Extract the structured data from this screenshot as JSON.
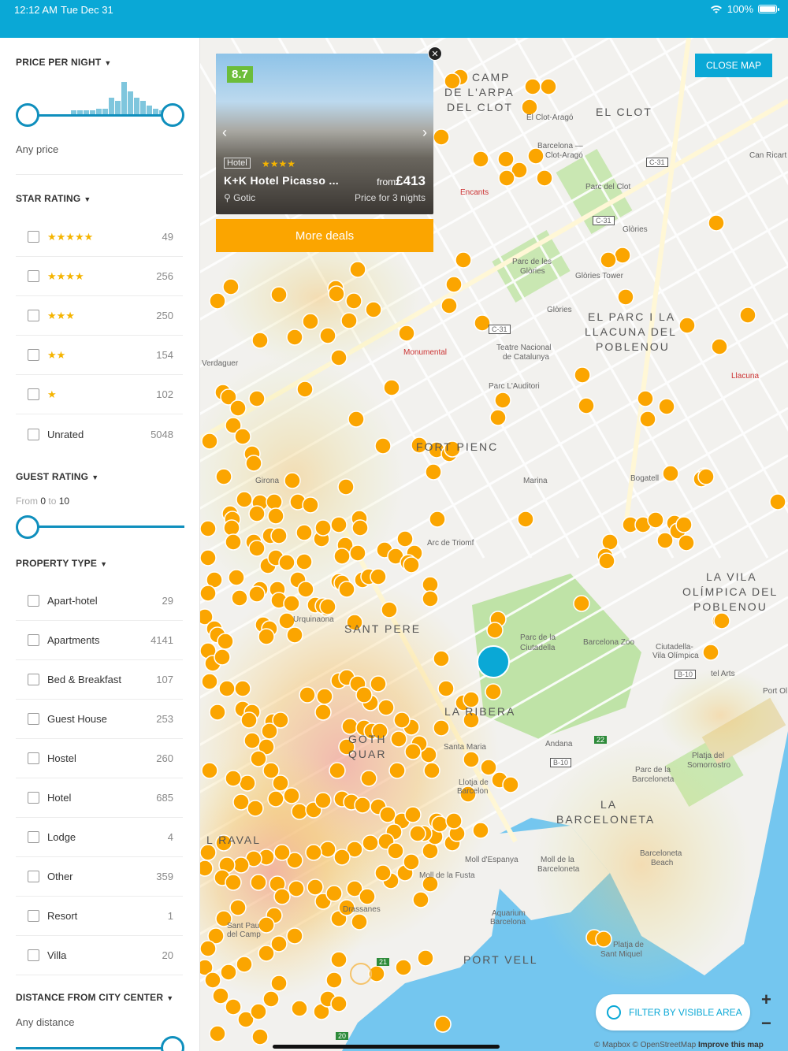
{
  "status": {
    "time": "12:12 AM",
    "date": "Tue Dec 31",
    "battery": "100%"
  },
  "sidebar": {
    "price": {
      "title": "PRICE PER NIGHT",
      "value": "Any price"
    },
    "star_rating": {
      "title": "STAR RATING",
      "items": [
        {
          "stars": "★★★★★",
          "count": "49"
        },
        {
          "stars": "★★★★",
          "count": "256"
        },
        {
          "stars": "★★★",
          "count": "250"
        },
        {
          "stars": "★★",
          "count": "154"
        },
        {
          "stars": "★",
          "count": "102"
        },
        {
          "label": "Unrated",
          "count": "5048"
        }
      ]
    },
    "guest_rating": {
      "title": "GUEST RATING",
      "from": "From",
      "min": "0",
      "to": "to",
      "max": "10"
    },
    "property_type": {
      "title": "PROPERTY TYPE",
      "items": [
        {
          "label": "Apart-hotel",
          "count": "29"
        },
        {
          "label": "Apartments",
          "count": "4141"
        },
        {
          "label": "Bed & Breakfast",
          "count": "107"
        },
        {
          "label": "Guest House",
          "count": "253"
        },
        {
          "label": "Hostel",
          "count": "260"
        },
        {
          "label": "Hotel",
          "count": "685"
        },
        {
          "label": "Lodge",
          "count": "4"
        },
        {
          "label": "Other",
          "count": "359"
        },
        {
          "label": "Resort",
          "count": "1"
        },
        {
          "label": "Villa",
          "count": "20"
        }
      ]
    },
    "distance": {
      "title": "DISTANCE FROM CITY CENTER",
      "value": "Any distance"
    }
  },
  "map": {
    "close_label": "CLOSE MAP",
    "card": {
      "score": "8.7",
      "type": "Hotel",
      "stars": "★★★★",
      "name": "K+K Hotel Picasso ...",
      "from": "from",
      "price": "£413",
      "location": "Gotic",
      "nights": "Price for 3 nights",
      "deals_label": "More deals"
    },
    "filter_label": "FILTER BY VISIBLE AREA",
    "zoom_in": "+",
    "zoom_out": "−",
    "attribution": "© Mapbox © OpenStreetMap",
    "improve": "Improve this map",
    "labels": {
      "camp": "CAMP",
      "arpa": "DE L'ARPA",
      "clot_dist": "DEL CLOT",
      "el_clot": "EL CLOT",
      "parc_clot": "Parc del Clot",
      "clot_arago": "El Clot-Aragó",
      "bcn_clot": "Barcelona —",
      "bcn_clot2": "Clot-Aragó",
      "encants": "Encants",
      "glories": "Glòries",
      "glories_tower": "Glòries Tower",
      "parc_glories": "Parc de les",
      "parc_glories2": "Glòries",
      "parc": "EL PARC I LA",
      "llacuna": "LLACUNA DEL",
      "poblenou": "POBLENOU",
      "llacuna_st": "Llacuna",
      "monumental": "Monumental",
      "teatre": "Teatre Nacional",
      "catalunya": "de Catalunya",
      "auditori": "Parc   L'Auditori",
      "fort_pienc": "FORT PIENC",
      "marina": "Marina",
      "bogatell": "Bogatell",
      "girona": "Girona",
      "arc": "Arc de Triomf",
      "sant_pere": "SANT PERE",
      "urquinaona": "Urquinaona",
      "ciutadella": "Parc de la",
      "ciutadella2": "Ciutadella",
      "zoo": "Barcelona Zoo",
      "vila_olimpica": "LA VILA",
      "vila_olimpica2": "OLÍMPICA DEL",
      "vila_olimpica3": "POBLENOU",
      "ciut_vila": "Ciutadella-",
      "ciut_vila2": "Vila Olímpica",
      "ribera": "LA RIBERA",
      "gothic": "GOTH",
      "gothic2": "QUAR",
      "santa_maria": "Santa Maria",
      "llotja": "Llotja de",
      "llotja2": "Barcelon",
      "andana": "Andana",
      "barceloneta": "LA",
      "barceloneta2": "BARCELONETA",
      "parc_barceloneta": "Parc de la",
      "parc_barceloneta2": "Barceloneta",
      "platja": "Platja del",
      "platja2": "Somorrostro",
      "raval": "L RAVAL",
      "moll_esp": "Moll d'Espanya",
      "moll_barc": "Moll de la",
      "moll_barc2": "Barceloneta",
      "moll_fusta": "Moll de la Fusta",
      "aquarium": "Aquarium",
      "aquarium2": "Barcelona",
      "drassanes": "Drassanes",
      "port_vell": "PORT VELL",
      "barceloneta_beach": "Barceloneta",
      "barceloneta_beach2": "Beach",
      "sant_miquel": "Platja de",
      "sant_miquel2": "Sant Miquel",
      "can_ricart": "Can Ricart",
      "verdaguer": "Verdaguer",
      "port_ol": "Port Ol",
      "hotel_arts": "tel Arts",
      "sant_pau": "Sant Pau",
      "sant_pau2": "del Camp",
      "c31a": "C-31",
      "c31b": "C-31",
      "c31c": "C-31",
      "b10a": "B-10",
      "b10b": "B-10",
      "n22": "22",
      "n21": "21",
      "n20": "20"
    }
  }
}
